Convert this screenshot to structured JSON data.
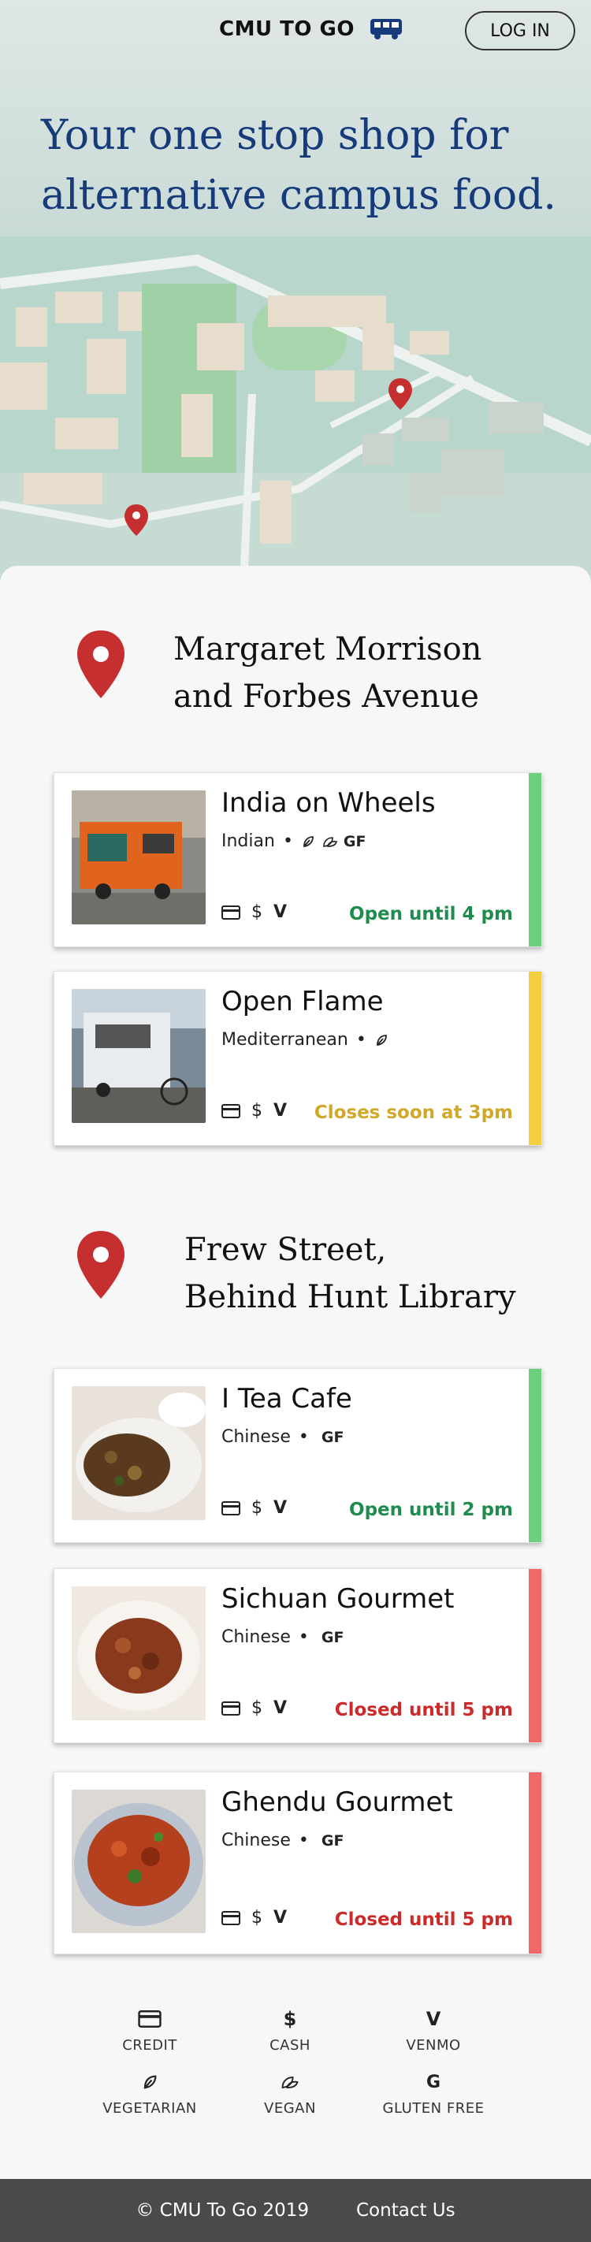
{
  "header": {
    "brand": "CMU TO GO",
    "login_label": "LOG IN"
  },
  "hero": {
    "title": "Your one stop shop for alternative campus food."
  },
  "colors": {
    "brand_blue": "#163a7a",
    "open": "#1f8c4e",
    "soon": "#d1a92a",
    "closed": "#cc2b2b",
    "bar_open": "#6ecf7e",
    "bar_soon": "#f4d03f",
    "bar_closed": "#f06a6a",
    "pin": "#c62f2f"
  },
  "locations": [
    {
      "name_line1": "Margaret Morrison",
      "name_line2": "and Forbes Avenue",
      "trucks": [
        {
          "name": "India on Wheels",
          "cuisine": "Indian",
          "diet_gf": "GF",
          "status": "Open until 4 pm"
        },
        {
          "name": "Open Flame",
          "cuisine": "Mediterranean",
          "status": "Closes soon at 3pm"
        }
      ]
    },
    {
      "name_line1": "Frew Street,",
      "name_line2": "Behind Hunt Library",
      "trucks": [
        {
          "name": "I Tea Cafe",
          "cuisine": "Chinese",
          "diet_gf": "GF",
          "status": "Open until 2 pm"
        },
        {
          "name": "Sichuan Gourmet",
          "cuisine": "Chinese",
          "diet_gf": "GF",
          "status": "Closed until 5 pm"
        },
        {
          "name": "Ghendu Gourmet",
          "cuisine": "Chinese",
          "diet_gf": "GF",
          "status": "Closed until 5 pm"
        }
      ]
    }
  ],
  "pay_symbols": {
    "cash": "$",
    "venmo": "V"
  },
  "legend": {
    "credit": "CREDIT",
    "cash": "CASH",
    "venmo": "VENMO",
    "vegetarian": "VEGETARIAN",
    "vegan": "VEGAN",
    "gluten_free": "GLUTEN FREE",
    "cash_symbol": "$",
    "venmo_symbol": "V",
    "gf_symbol": "G"
  },
  "footer": {
    "copyright": "© CMU To Go 2019",
    "contact": "Contact Us"
  }
}
